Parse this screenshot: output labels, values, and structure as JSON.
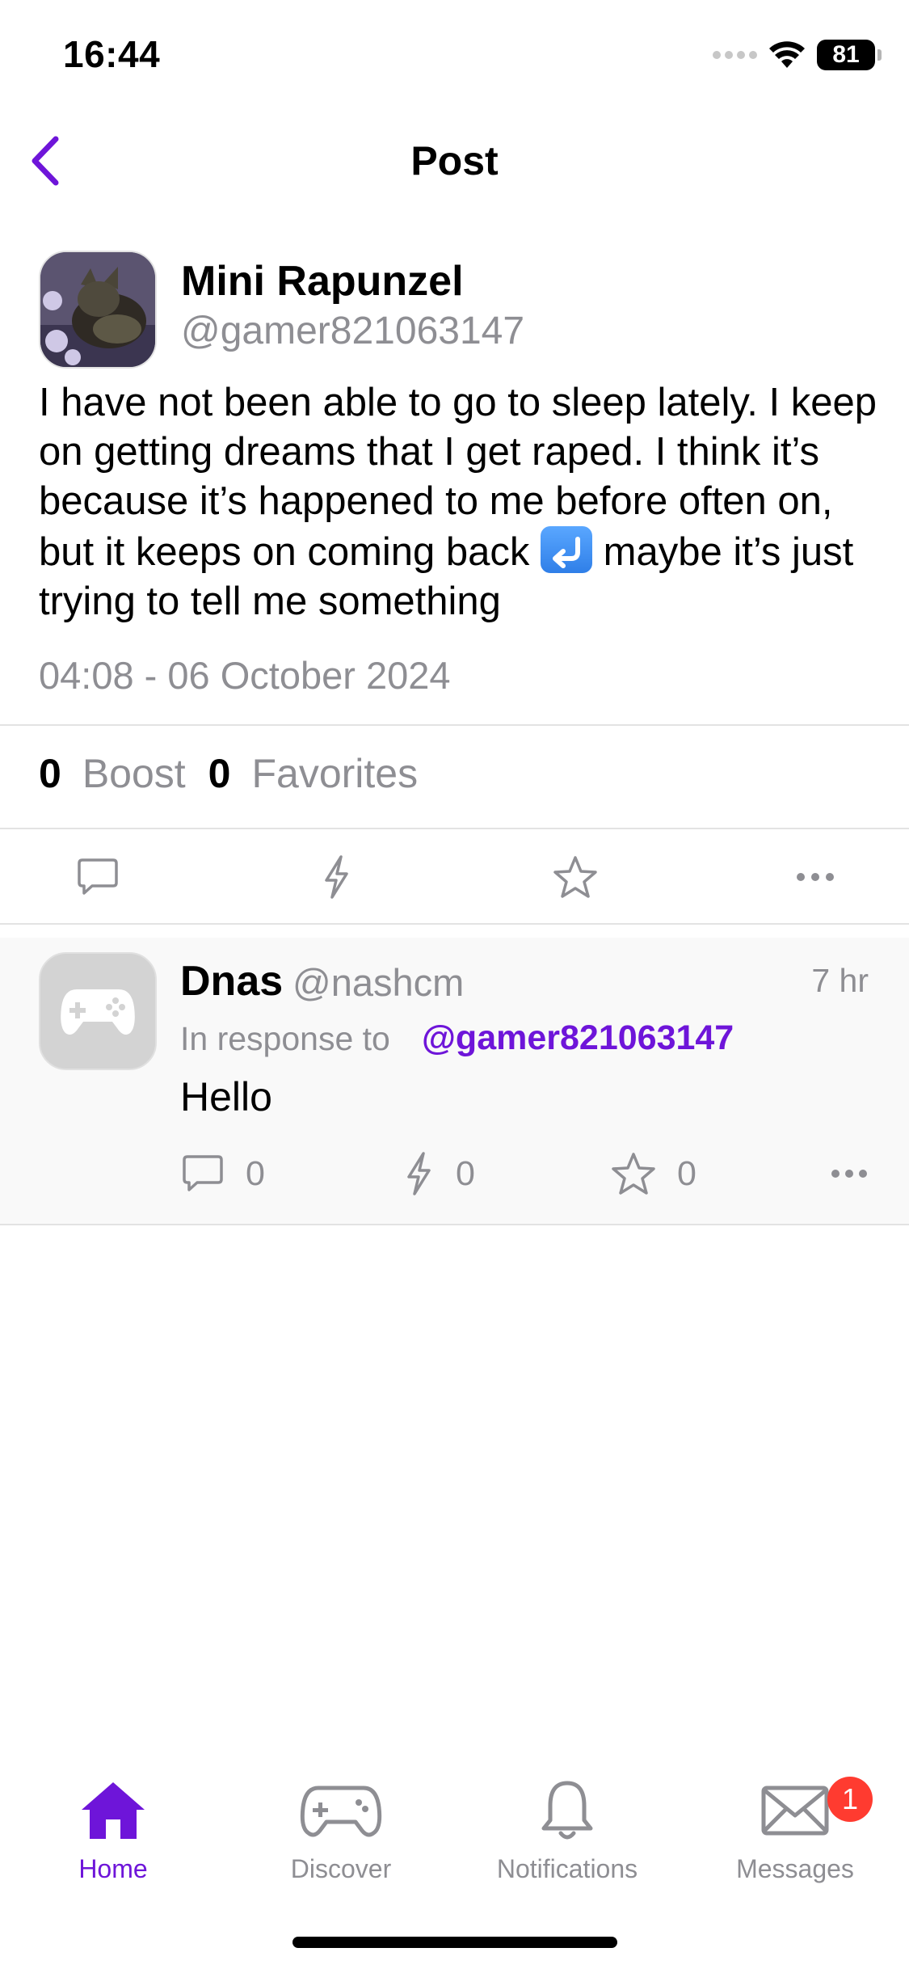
{
  "status_bar": {
    "time": "16:44",
    "battery": "81"
  },
  "nav": {
    "title": "Post"
  },
  "post": {
    "author_name": "Mini Rapunzel",
    "author_handle": "@gamer821063147",
    "text": "I have not been able to go to sleep lately. I keep on getting dreams that I get raped. I think it’s because it’s happened to me before often on, but it keeps on coming back",
    "text_tail": "maybe it’s just trying to tell me something",
    "emoji": "return-arrow-emoji",
    "date": "04:08 - 06 October 2024",
    "boost_count": "0",
    "boost_label": "Boost",
    "favorites_count": "0",
    "favorites_label": "Favorites"
  },
  "reply": {
    "name": "Dnas",
    "handle": "@nashcm",
    "time": "7 hr",
    "response_label": "In response to",
    "mention": "@gamer821063147",
    "text": "Hello",
    "comment_count": "0",
    "boost_count": "0",
    "favorite_count": "0"
  },
  "tabs": [
    {
      "label": "Home",
      "icon": "home-icon",
      "active": true
    },
    {
      "label": "Discover",
      "icon": "gamepad-icon",
      "active": false
    },
    {
      "label": "Notifications",
      "icon": "bell-icon",
      "active": false
    },
    {
      "label": "Messages",
      "icon": "envelope-icon",
      "active": false,
      "badge": "1"
    }
  ],
  "colors": {
    "accent": "#6e15d9",
    "muted": "#8e8e93",
    "badge": "#ff3b30"
  }
}
